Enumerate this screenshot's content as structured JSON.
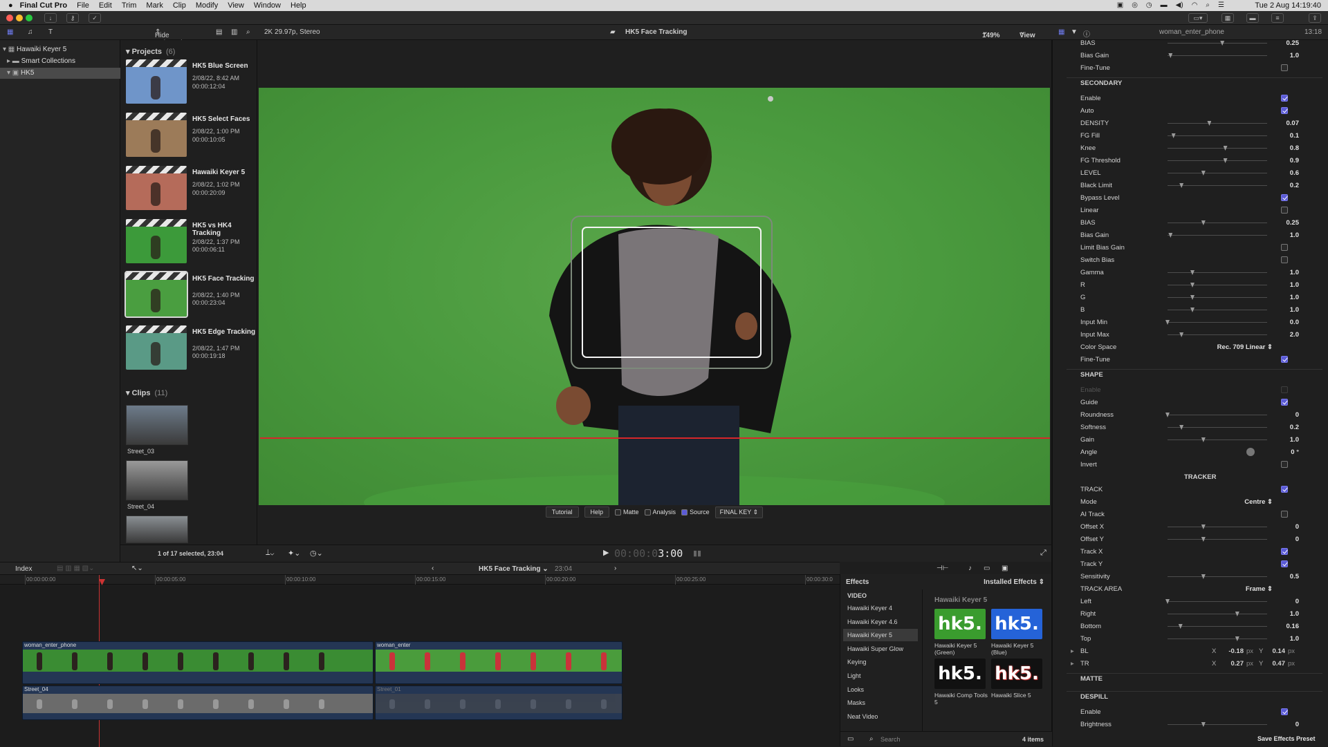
{
  "menu": {
    "app": "Final Cut Pro",
    "items": [
      "File",
      "Edit",
      "Trim",
      "Mark",
      "Clip",
      "Modify",
      "View",
      "Window",
      "Help"
    ],
    "clock": "Tue 2 Aug  14:19:40"
  },
  "toolbar": {
    "filter": "Hide Rejected",
    "format": "2K 29.97p, Stereo",
    "project": "HK5 Face Tracking",
    "zoom": "149%",
    "view": "View",
    "inspector_clip": "woman_enter_phone",
    "inspector_time": "13:18"
  },
  "libraries": [
    {
      "label": "Hawaiki Keyer 5",
      "indent": 0,
      "selected": false
    },
    {
      "label": "Smart Collections",
      "indent": 1,
      "selected": false
    },
    {
      "label": "HK5",
      "indent": 1,
      "selected": true
    }
  ],
  "browser": {
    "projects_label": "Projects",
    "projects_count": "(6)",
    "projects": [
      {
        "name": "HK5 Blue Screen",
        "date": "2/08/22, 8:42 AM",
        "dur": "00:00:12:04",
        "thumb": "#6f95c9"
      },
      {
        "name": "HK5 Select Faces",
        "date": "2/08/22, 1:00 PM",
        "dur": "00:00:10:05",
        "thumb": "#9c7b59"
      },
      {
        "name": "Hawaiki Keyer 5",
        "date": "2/08/22, 1:02 PM",
        "dur": "00:00:20:09",
        "thumb": "#b56b5a"
      },
      {
        "name": "HK5 vs HK4 Tracking",
        "date": "2/08/22, 1:37 PM",
        "dur": "00:00:06:11",
        "thumb": "#3c9a3a"
      },
      {
        "name": "HK5 Face Tracking",
        "date": "2/08/22, 1:40 PM",
        "dur": "00:00:23:04",
        "thumb": "#4a9e40"
      },
      {
        "name": "HK5 Edge Tracking",
        "date": "2/08/22, 1:47 PM",
        "dur": "00:00:19:18",
        "thumb": "#5a9a86"
      }
    ],
    "clips_label": "Clips",
    "clips_count": "(11)",
    "clips": [
      {
        "name": "Street_03"
      },
      {
        "name": "Street_04"
      },
      {
        "name": ""
      }
    ],
    "status": "1 of 17 selected, 23:04"
  },
  "viewer": {
    "buttons": [
      "Tutorial",
      "Help"
    ],
    "checks": [
      {
        "label": "Matte",
        "on": false
      },
      {
        "label": "Analysis",
        "on": false
      },
      {
        "label": "Source",
        "on": true
      }
    ],
    "mode": "FINAL KEY",
    "timecode_dim": "00:00:0",
    "timecode": "3:00"
  },
  "inspector": {
    "rows": [
      {
        "label": "BIAS",
        "kind": "slider",
        "knob": 0.55,
        "value": "0.25"
      },
      {
        "label": "Bias Gain",
        "kind": "slider",
        "knob": 0.03,
        "value": "1.0"
      },
      {
        "label": "Fine-Tune",
        "kind": "check",
        "on": false
      },
      {
        "label": "SECONDARY",
        "kind": "header"
      },
      {
        "label": "Enable",
        "kind": "check",
        "on": true
      },
      {
        "label": "Auto",
        "kind": "check",
        "on": true
      },
      {
        "label": "DENSITY",
        "kind": "slider",
        "knob": 0.42,
        "value": "0.07"
      },
      {
        "label": "FG Fill",
        "kind": "slider",
        "knob": 0.06,
        "value": "0.1"
      },
      {
        "label": "Knee",
        "kind": "slider",
        "knob": 0.58,
        "value": "0.8"
      },
      {
        "label": "FG Threshold",
        "kind": "slider",
        "knob": 0.58,
        "value": "0.9"
      },
      {
        "label": "LEVEL",
        "kind": "slider",
        "knob": 0.36,
        "value": "0.6"
      },
      {
        "label": "Black Limit",
        "kind": "slider",
        "knob": 0.14,
        "value": "0.2"
      },
      {
        "label": "Bypass Level",
        "kind": "check",
        "on": true
      },
      {
        "label": "Linear",
        "kind": "check",
        "on": false
      },
      {
        "label": "BIAS",
        "kind": "slider",
        "knob": 0.36,
        "value": "0.25"
      },
      {
        "label": "Bias Gain",
        "kind": "slider",
        "knob": 0.03,
        "value": "1.0"
      },
      {
        "label": "Limit Bias Gain",
        "kind": "check",
        "on": false
      },
      {
        "label": "Switch Bias",
        "kind": "check",
        "on": false
      },
      {
        "label": "Gamma",
        "kind": "slider",
        "knob": 0.25,
        "value": "1.0"
      },
      {
        "label": "R",
        "kind": "slider",
        "knob": 0.25,
        "value": "1.0"
      },
      {
        "label": "G",
        "kind": "slider",
        "knob": 0.25,
        "value": "1.0"
      },
      {
        "label": "B",
        "kind": "slider",
        "knob": 0.25,
        "value": "1.0"
      },
      {
        "label": "Input Min",
        "kind": "slider",
        "knob": 0.0,
        "value": "0.0"
      },
      {
        "label": "Input Max",
        "kind": "slider",
        "knob": 0.14,
        "value": "2.0"
      },
      {
        "label": "Color Space",
        "kind": "select",
        "value": "Rec. 709 Linear"
      },
      {
        "label": "Fine-Tune",
        "kind": "check",
        "on": true
      },
      {
        "label": "SHAPE",
        "kind": "header"
      },
      {
        "label": "Enable",
        "kind": "check",
        "on": false,
        "dim": true
      },
      {
        "label": "Guide",
        "kind": "check",
        "on": true
      },
      {
        "label": "Roundness",
        "kind": "slider",
        "knob": 0.0,
        "value": "0"
      },
      {
        "label": "Softness",
        "kind": "slider",
        "knob": 0.14,
        "value": "0.2"
      },
      {
        "label": "Gain",
        "kind": "slider",
        "knob": 0.36,
        "value": "1.0"
      },
      {
        "label": "Angle",
        "kind": "angle",
        "value": "0 °"
      },
      {
        "label": "Invert",
        "kind": "check",
        "on": false
      },
      {
        "label": "TRACKER",
        "kind": "center"
      },
      {
        "label": "TRACK",
        "kind": "check",
        "on": true
      },
      {
        "label": "Mode",
        "kind": "select",
        "value": "Centre"
      },
      {
        "label": "AI Track",
        "kind": "check",
        "on": false
      },
      {
        "label": "Offset X",
        "kind": "slider",
        "knob": 0.36,
        "value": "0"
      },
      {
        "label": "Offset Y",
        "kind": "slider",
        "knob": 0.36,
        "value": "0"
      },
      {
        "label": "Track X",
        "kind": "check",
        "on": true
      },
      {
        "label": "Track Y",
        "kind": "check",
        "on": true
      },
      {
        "label": "Sensitivity",
        "kind": "slider",
        "knob": 0.36,
        "value": "0.5"
      },
      {
        "label": "TRACK AREA",
        "kind": "select",
        "value": "Frame"
      },
      {
        "label": "Left",
        "kind": "slider",
        "knob": 0.0,
        "value": "0"
      },
      {
        "label": "Right",
        "kind": "slider",
        "knob": 0.7,
        "value": "1.0"
      },
      {
        "label": "Bottom",
        "kind": "slider",
        "knob": 0.13,
        "value": "0.16"
      },
      {
        "label": "Top",
        "kind": "slider",
        "knob": 0.7,
        "value": "1.0"
      },
      {
        "label": "BL",
        "kind": "xy",
        "x": "-0.18",
        "y": "0.14",
        "unit": "px"
      },
      {
        "label": "TR",
        "kind": "xy",
        "x": "0.27",
        "y": "0.47",
        "unit": "px"
      },
      {
        "label": "MATTE",
        "kind": "header"
      },
      {
        "label": "DESPILL",
        "kind": "header"
      },
      {
        "label": "Enable",
        "kind": "check",
        "on": true
      },
      {
        "label": "Brightness",
        "kind": "slider",
        "knob": 0.36,
        "value": "0"
      }
    ],
    "save_preset": "Save Effects Preset"
  },
  "timeline": {
    "index": "Index",
    "project": "HK5 Face Tracking",
    "duration": "23:04",
    "ruler": [
      "00:00:00:00",
      "00:00:05:00",
      "00:00:10:00",
      "00:00:15:00",
      "00:00:20:00",
      "00:00:25:00",
      "00:00:30:0"
    ],
    "clips": [
      {
        "name": "woman_enter_phone",
        "lane": "primary"
      },
      {
        "name": "woman_enter",
        "lane": "primary"
      },
      {
        "name": "Street_04",
        "lane": "secondary"
      },
      {
        "name": "Street_01",
        "lane": "secondary"
      }
    ]
  },
  "effects": {
    "title": "Effects",
    "filter": "Installed Effects",
    "category_head": "VIDEO",
    "categories": [
      "Hawaiki Keyer 4",
      "Hawaiki Keyer 4.6",
      "Hawaiki Keyer 5",
      "Hawaiki Super Glow",
      "Keying",
      "Light",
      "Looks",
      "Masks",
      "Neat Video"
    ],
    "selected_index": 2,
    "group": "Hawaiki Keyer 5",
    "tiles": [
      {
        "name": "Hawaiki Keyer 5 (Green)",
        "logo": "hk5.",
        "bg": "#3a9c2e"
      },
      {
        "name": "Hawaiki Keyer 5 (Blue)",
        "logo": "hk5.",
        "bg": "#2563d8"
      },
      {
        "name": "Hawaiki Comp Tools 5",
        "logo": "hk5.",
        "bg": "#111111"
      },
      {
        "name": "Hawaiki Slice 5",
        "logo": "hk5.",
        "bg": "#111111"
      }
    ],
    "search_placeholder": "Search",
    "count": "4 items"
  }
}
